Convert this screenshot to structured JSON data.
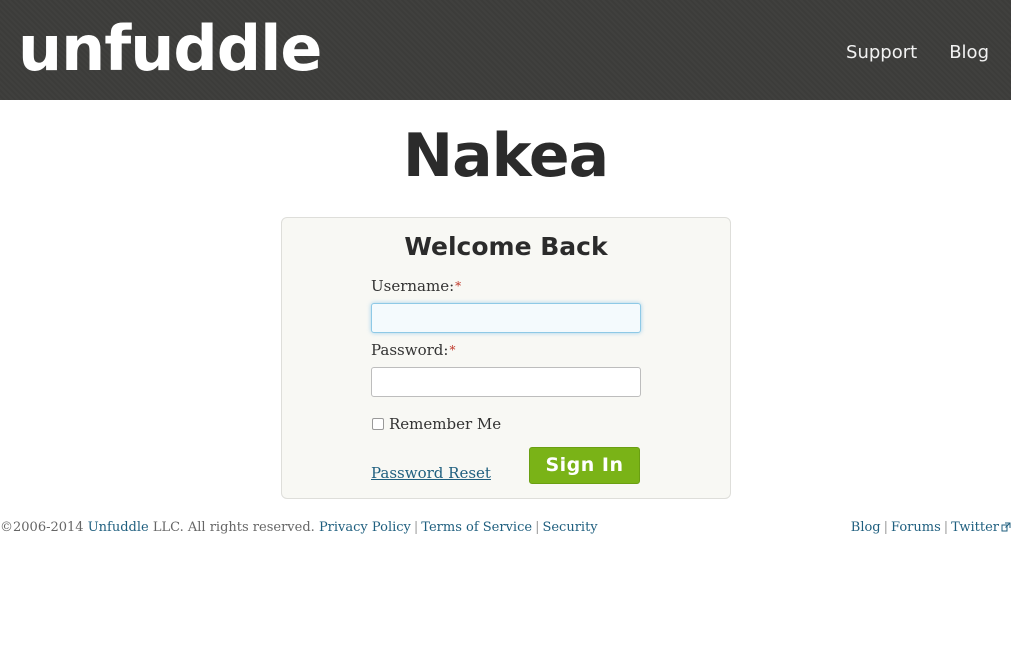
{
  "header": {
    "logo_text": "unfuddle",
    "nav": [
      {
        "label": "Support"
      },
      {
        "label": "Blog"
      }
    ]
  },
  "site_title": "Nakea",
  "login": {
    "title": "Welcome Back",
    "username_label": "Username:",
    "password_label": "Password:",
    "required_mark": "*",
    "username_value": "",
    "password_value": "",
    "remember_label": "Remember Me",
    "remember_checked": false,
    "reset_label": "Password Reset",
    "submit_label": "Sign In"
  },
  "footer": {
    "copyright_prefix": "©2006-2014",
    "company_link": "Unfuddle",
    "copyright_suffix": "LLC. All rights reserved.",
    "left_links": [
      "Privacy Policy",
      "Terms of Service",
      "Security"
    ],
    "right_links": [
      "Blog",
      "Forums",
      "Twitter"
    ],
    "separator": "|"
  },
  "colors": {
    "header_bg": "#3d3d3b",
    "link": "#1f5f7f",
    "button_green": "#7ab317",
    "required_red": "#c0392b"
  }
}
